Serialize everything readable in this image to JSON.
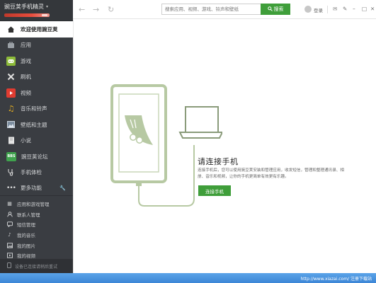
{
  "app": {
    "title": "豌豆荚手机精灵",
    "title_caret": "▾"
  },
  "sidebar": {
    "items": [
      {
        "label": "欢迎使用豌豆荚",
        "icon": "home-icon",
        "color": "#e6e6e6",
        "active": true
      },
      {
        "label": "应用",
        "icon": "bag-icon",
        "color": "#8b8f95",
        "active": false
      },
      {
        "label": "游戏",
        "icon": "gamepad-icon",
        "color": "#8dbb3a",
        "active": false
      },
      {
        "label": "刷机",
        "icon": "wrench-cross-icon",
        "color": "#d6d6d6",
        "active": false
      },
      {
        "label": "视频",
        "icon": "video-icon",
        "color": "#e03c31",
        "active": false
      },
      {
        "label": "音乐和铃声",
        "icon": "music-icon",
        "color": "#e8b021",
        "active": false
      },
      {
        "label": "壁纸和主题",
        "icon": "wallpaper-icon",
        "color": "#7d8ea0",
        "active": false
      },
      {
        "label": "小说",
        "icon": "book-icon",
        "color": "#d9d9d9",
        "active": false
      },
      {
        "label": "豌豆荚论坛",
        "icon": "bbs-icon",
        "color": "#3fa34d",
        "active": false
      },
      {
        "label": "手机体检",
        "icon": "stethoscope-icon",
        "color": "#d9d9d9",
        "active": false
      }
    ],
    "more": {
      "label": "更多功能",
      "icon": "dots-icon"
    },
    "sub_items": [
      {
        "label": "应用和游戏管理",
        "icon": "grid-icon"
      },
      {
        "label": "联系人管理",
        "icon": "contact-icon"
      },
      {
        "label": "短信管理",
        "icon": "message-icon"
      },
      {
        "label": "我的音乐",
        "icon": "note-icon"
      },
      {
        "label": "我的图片",
        "icon": "picture-icon"
      },
      {
        "label": "我的视频",
        "icon": "film-icon"
      }
    ],
    "footer": "设备已连接请稍后重试"
  },
  "toolbar": {
    "search_placeholder": "搜索应用、视频、游戏、铃声和壁纸",
    "search_label": "搜索",
    "login_label": "登录"
  },
  "main": {
    "connect_title": "请连接手机",
    "connect_description": "连接手机后，您可以使用豌豆荚安装和管理应用，收发短信，管理和整理通讯录、相册、音乐和视频，让你的手机更简单有效更有乐趣。",
    "connect_button": "连接手机"
  },
  "status_bar": {
    "text": "http://www.xiazai.com/ 注册下载站"
  },
  "colors": {
    "accent_green": "#3f9e3a",
    "sidebar_bg": "#3a3d42",
    "illustration": "#b7c9a3"
  }
}
